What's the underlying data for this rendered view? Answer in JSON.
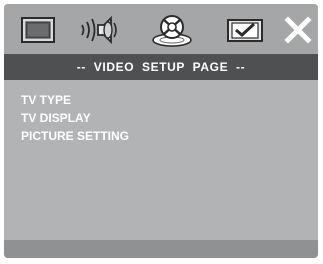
{
  "tabs": [
    {
      "id": "general",
      "icon": "monitor-icon"
    },
    {
      "id": "audio",
      "icon": "speaker-sound-icon"
    },
    {
      "id": "video",
      "icon": "video-disc-icon",
      "active": true
    },
    {
      "id": "preference",
      "icon": "checked-screen-icon"
    },
    {
      "id": "exit",
      "icon": "close-icon"
    }
  ],
  "page_title": "--  VIDEO  SETUP  PAGE  --",
  "menu": {
    "items": [
      {
        "label": "TV TYPE"
      },
      {
        "label": "TV DISPLAY"
      },
      {
        "label": "PICTURE SETTING"
      }
    ]
  },
  "colors": {
    "background": "#b1b3b5",
    "tab_bar": "#a4a6a8",
    "title_bar": "#4f5052",
    "text": "#ffffff"
  }
}
